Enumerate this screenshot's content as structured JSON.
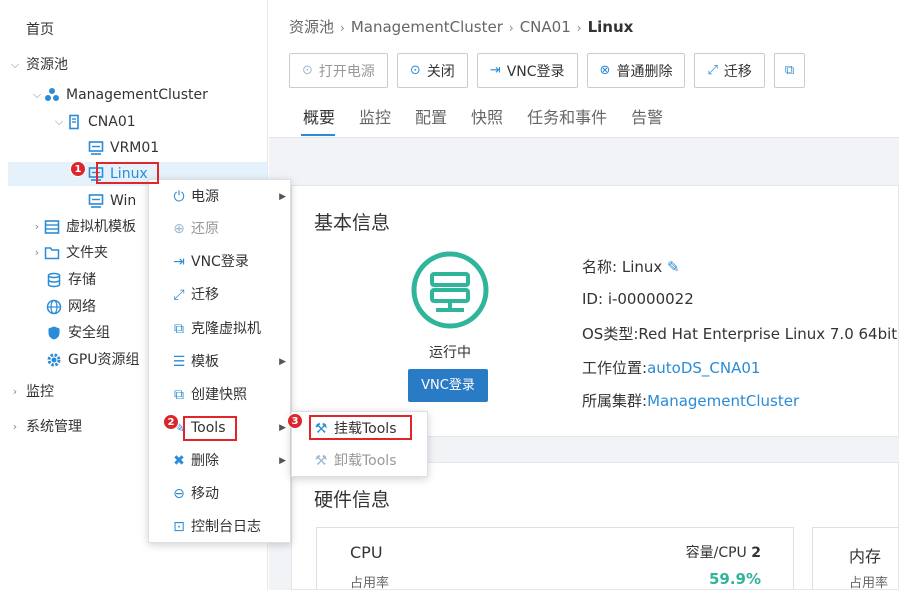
{
  "sidebar": {
    "items": [
      {
        "label": "首页"
      },
      {
        "label": "资源池"
      },
      {
        "label": "ManagementCluster"
      },
      {
        "label": "CNA01"
      },
      {
        "label": "VRM01"
      },
      {
        "label": "Linux"
      },
      {
        "label": "Win"
      },
      {
        "label": "虚拟机模板"
      },
      {
        "label": "文件夹"
      },
      {
        "label": "存储"
      },
      {
        "label": "网络"
      },
      {
        "label": "安全组"
      },
      {
        "label": "GPU资源组"
      },
      {
        "label": "监控"
      },
      {
        "label": "系统管理"
      }
    ]
  },
  "breadcrumb": {
    "parts": [
      "资源池",
      "ManagementCluster",
      "CNA01"
    ],
    "current": "Linux"
  },
  "toolbar": {
    "buttons": [
      "打开电源",
      "关闭",
      "VNC登录",
      "普通删除",
      "迁移"
    ]
  },
  "tabs": [
    "概要",
    "监控",
    "配置",
    "快照",
    "任务和事件",
    "告警"
  ],
  "basic": {
    "title": "基本信息",
    "status": "运行中",
    "vnc_button": "VNC登录",
    "name_label": "名称:",
    "name_value": "Linux",
    "id_label": "ID:",
    "id_value": "i-00000022",
    "os_label": "OS类型:",
    "os_value": "Red Hat Enterprise Linux 7.0 64bit",
    "location_label": "工作位置:",
    "location_value": "autoDS_CNA01",
    "cluster_label": "所属集群:",
    "cluster_value": "ManagementCluster"
  },
  "hardware": {
    "title": "硬件信息",
    "cpu_label": "CPU",
    "cpu_capacity_label": "容量/CPU",
    "cpu_capacity_value": "2",
    "cpu_usage_label": "占用率",
    "cpu_usage_value": "59.9%",
    "mem_label": "内存",
    "mem_usage_label": "占用率"
  },
  "context_menu": {
    "items": [
      "电源",
      "还原",
      "VNC登录",
      "迁移",
      "克隆虚拟机",
      "模板",
      "创建快照",
      "Tools",
      "删除",
      "移动",
      "控制台日志"
    ]
  },
  "submenu": {
    "items": [
      "挂载Tools",
      "卸载Tools"
    ]
  },
  "badges": [
    "1",
    "2",
    "3"
  ],
  "colors": {
    "accent": "#2a8bd6",
    "highlight": "#e0262b",
    "status_green": "#2fb59a"
  }
}
